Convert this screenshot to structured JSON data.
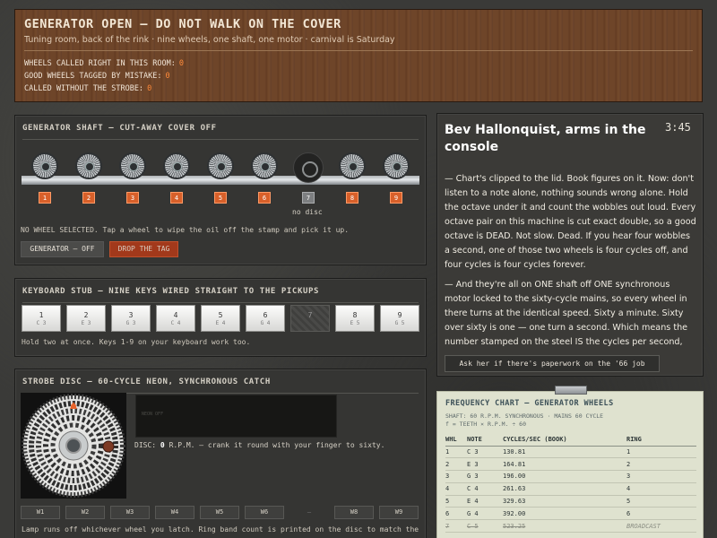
{
  "header": {
    "title": "GENERATOR OPEN — DO NOT WALK ON THE COVER",
    "subtitle": "Tuning room, back of the rink · nine wheels, one shaft, one motor · carnival is Saturday",
    "stats": [
      {
        "label": "WHEELS CALLED RIGHT IN THIS ROOM:",
        "value": "0"
      },
      {
        "label": "GOOD WHEELS TAGGED BY MISTAKE:",
        "value": "0"
      },
      {
        "label": "CALLED WITHOUT THE STROBE:",
        "value": "0"
      }
    ]
  },
  "generator": {
    "title": "GENERATOR SHAFT — CUT-AWAY COVER OFF",
    "wheel_numbers": [
      "1",
      "2",
      "3",
      "4",
      "5",
      "6",
      "7",
      "8",
      "9"
    ],
    "missing_label": "no disc",
    "message": "NO WHEEL SELECTED. Tap a wheel to wipe the oil off the stamp and pick it up.",
    "btn_generator": "GENERATOR — OFF",
    "btn_tag": "DROP THE TAG"
  },
  "keyboard": {
    "title": "KEYBOARD STUB — NINE KEYS WIRED STRAIGHT TO THE PICKUPS",
    "keys": [
      {
        "n": "1",
        "note": "C 3"
      },
      {
        "n": "2",
        "note": "E 3"
      },
      {
        "n": "3",
        "note": "G 3"
      },
      {
        "n": "4",
        "note": "C 4"
      },
      {
        "n": "5",
        "note": "E 4"
      },
      {
        "n": "6",
        "note": "G 4"
      },
      {
        "n": "7",
        "note": ""
      },
      {
        "n": "8",
        "note": "E 5"
      },
      {
        "n": "9",
        "note": "G 5"
      }
    ],
    "hint": "Hold two at once. Keys 1-9 on your keyboard work too."
  },
  "strobe": {
    "title": "STROBE DISC — 60-CYCLE NEON, SYNCHRONOUS CATCH",
    "neon_label": "NEON OFF",
    "rpm_prefix": "DISC:",
    "rpm_value": "0",
    "rpm_text": "R.P.M. — crank it round with your finger to sixty.",
    "buttons": [
      "W1",
      "W2",
      "W3",
      "W4",
      "W5",
      "W6",
      "—",
      "W8",
      "W9"
    ],
    "lamp": "Lamp runs off whichever wheel you latch. Ring band count is printed on the disc to match the"
  },
  "dialogue": {
    "name": "Bev Hallonquist, arms in the console",
    "clock": "3:45",
    "paragraphs": [
      "— Chart's clipped to the lid. Book figures on it. Now: don't listen to a note alone, nothing sounds wrong alone. Hold the octave under it and count the wobbles out loud. Every octave pair on this machine is cut exact double, so a good octave is DEAD. Not slow. Dead. If you hear four wobbles a second, one of those two wheels is four cycles off, and four cycles is four cycles forever.",
      "— And they're all on ONE shaft off ONE synchronous motor locked to the sixty-cycle mains, so every wheel in there turns at the identical speed. Sixty a minute. Sixty over sixty is one — one turn a second. Which means the number stamped on the steel IS the cycles per second, straight across, and the only variable in this entire instrument is how many teeth a man cut into a disc. This thing hasn't moved a cent of tuning"
    ],
    "ask": "Ask her if there's paperwork on the '66 job"
  },
  "chart": {
    "title": "FREQUENCY CHART — GENERATOR WHEELS",
    "sub1": "SHAFT: 60 R.P.M. SYNCHRONOUS · MAINS 60 CYCLE",
    "sub2": "f = TEETH × R.P.M. ÷ 60",
    "headers": [
      "WHL",
      "NOTE",
      "CYCLES/SEC (BOOK)",
      "RING"
    ],
    "rows": [
      [
        "1",
        "C 3",
        "130.81",
        "1"
      ],
      [
        "2",
        "E 3",
        "164.81",
        "2"
      ],
      [
        "3",
        "G 3",
        "196.00",
        "3"
      ],
      [
        "4",
        "C 4",
        "261.63",
        "4"
      ],
      [
        "5",
        "E 4",
        "329.63",
        "5"
      ],
      [
        "6",
        "G 4",
        "392.00",
        "6"
      ],
      [
        "7",
        "C 5",
        "523.25",
        "BROADCAST"
      ]
    ]
  },
  "colors": {
    "accent": "#d8602a",
    "stat_value": "#ff8a3a",
    "header_wood": "#6e4529",
    "chart_paper": "#dfe2cf"
  }
}
